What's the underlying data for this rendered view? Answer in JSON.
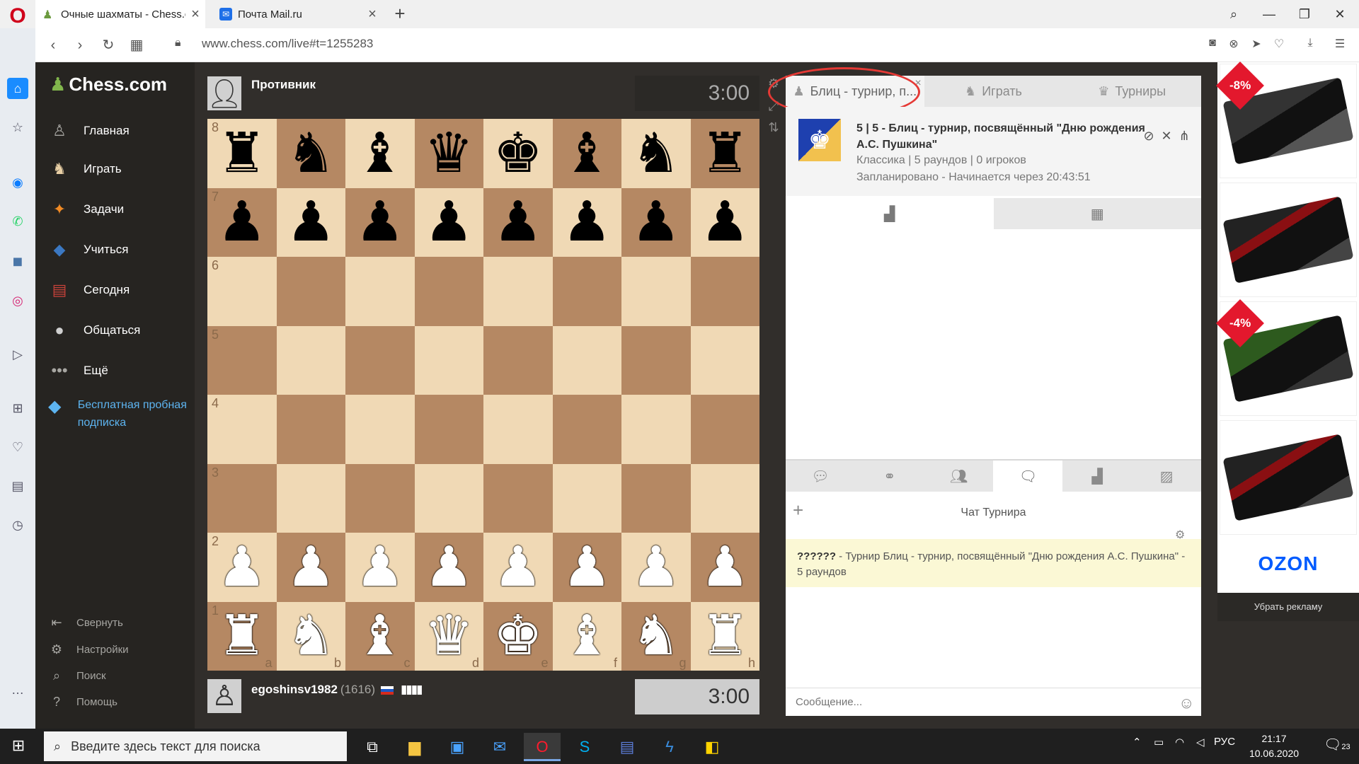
{
  "browser": {
    "tabs": [
      {
        "label": "Очные шахматы - Chess.co",
        "active": true
      },
      {
        "label": "Почта Mail.ru",
        "active": false
      }
    ],
    "url": "www.chess.com/live#t=1255283"
  },
  "nav": {
    "logo": "Chess.com",
    "items": [
      {
        "label": "Главная"
      },
      {
        "label": "Играть"
      },
      {
        "label": "Задачи"
      },
      {
        "label": "Учиться"
      },
      {
        "label": "Сегодня"
      },
      {
        "label": "Общаться"
      },
      {
        "label": "Ещё"
      }
    ],
    "trial": "Бесплатная пробная подписка",
    "bottom": [
      {
        "label": "Свернуть"
      },
      {
        "label": "Настройки"
      },
      {
        "label": "Поиск"
      },
      {
        "label": "Помощь"
      }
    ]
  },
  "game": {
    "opponent": {
      "name": "Противник",
      "clock": "3:00"
    },
    "player": {
      "name": "egoshinsv1982",
      "rating": "(1616)",
      "bars": "▮▮▮▮",
      "clock": "3:00"
    },
    "ranks": [
      "8",
      "7",
      "6",
      "5",
      "4",
      "3",
      "2",
      "1"
    ],
    "files": [
      "a",
      "b",
      "c",
      "d",
      "e",
      "f",
      "g",
      "h"
    ],
    "position": [
      [
        "r",
        "n",
        "b",
        "q",
        "k",
        "b",
        "n",
        "r"
      ],
      [
        "p",
        "p",
        "p",
        "p",
        "p",
        "p",
        "p",
        "p"
      ],
      [
        "",
        "",
        "",
        "",
        "",
        "",
        "",
        ""
      ],
      [
        "",
        "",
        "",
        "",
        "",
        "",
        "",
        ""
      ],
      [
        "",
        "",
        "",
        "",
        "",
        "",
        "",
        ""
      ],
      [
        "",
        "",
        "",
        "",
        "",
        "",
        "",
        ""
      ],
      [
        "P",
        "P",
        "P",
        "P",
        "P",
        "P",
        "P",
        "P"
      ],
      [
        "R",
        "N",
        "B",
        "Q",
        "K",
        "B",
        "N",
        "R"
      ]
    ]
  },
  "panel": {
    "tabs": [
      {
        "label": "Блиц - турнир, п...",
        "active": true
      },
      {
        "label": "Играть",
        "active": false
      },
      {
        "label": "Турниры",
        "active": false
      }
    ],
    "tournament": {
      "title": "5 | 5 - Блиц - турнир, посвящённый \"Дню рождения А.С. Пушкина\"",
      "info": "Классика | 5 раундов | 0 игроков",
      "schedule": "Запланировано - Начинается через 20:43:51"
    },
    "chat": {
      "title": "Чат Турнира",
      "message_author": "??????",
      "message_text": " - Турнир Блиц - турнир, посвящённый \"Дню рождения А.С. Пушкина\" - 5 раундов",
      "input_placeholder": "Сообщение..."
    }
  },
  "ads": {
    "badges": [
      "-8%",
      "-4%"
    ],
    "brand": "OZON",
    "remove": "Убрать рекламу"
  },
  "taskbar": {
    "search_placeholder": "Введите здесь текст для поиска",
    "language": "РУС",
    "time": "21:17",
    "date": "10.06.2020",
    "notifications": "23"
  }
}
